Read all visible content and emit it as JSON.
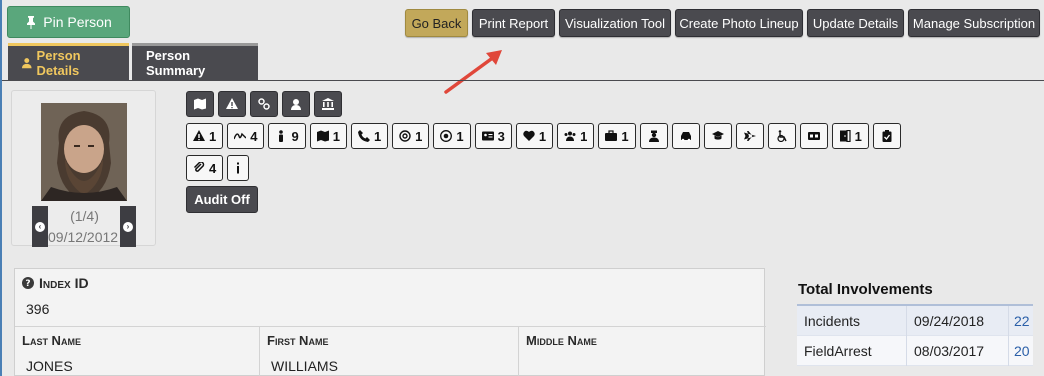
{
  "colors": {
    "accent": "#f0c75e",
    "pin": "#5aa77c",
    "go_back": "#c2a85a",
    "dark_button": "#4a4a4f",
    "link": "#2a5fa8",
    "arrow": "#e0473a"
  },
  "toolbar": {
    "pin_label": "Pin Person",
    "go_back": "Go Back",
    "print_report": "Print Report",
    "visualization_tool": "Visualization Tool",
    "photo_lineup": "Create Photo Lineup",
    "update_details": "Update Details",
    "manage_subscription": "Manage Subscription"
  },
  "tabs": [
    {
      "label": "Person Details",
      "icon": "user-icon",
      "active": true
    },
    {
      "label": "Person Summary",
      "active": false
    }
  ],
  "photo": {
    "counter": "(1/4)",
    "date": "09/12/2012"
  },
  "icon_bar_top": [
    "map-icon",
    "warning-icon",
    "link-icon",
    "user-secret-icon",
    "bank-icon"
  ],
  "icon_bar_main": [
    {
      "icon": "warning-icon",
      "count": "1"
    },
    {
      "icon": "signature-icon",
      "count": "4"
    },
    {
      "icon": "person-icon",
      "count": "9"
    },
    {
      "icon": "map-icon",
      "count": "1"
    },
    {
      "icon": "phone-icon",
      "count": "1"
    },
    {
      "icon": "at-icon",
      "count": "1"
    },
    {
      "icon": "target-icon",
      "count": "1"
    },
    {
      "icon": "id-card-icon",
      "count": "3"
    },
    {
      "icon": "heart-icon",
      "count": "1"
    },
    {
      "icon": "group-icon",
      "count": "1"
    },
    {
      "icon": "briefcase-icon",
      "count": "1"
    },
    {
      "icon": "officer-icon",
      "count": ""
    },
    {
      "icon": "car-icon",
      "count": ""
    },
    {
      "icon": "graduation-cap-icon",
      "count": ""
    },
    {
      "icon": "plane-icon",
      "count": ""
    },
    {
      "icon": "wheelchair-icon",
      "count": ""
    },
    {
      "icon": "language-icon",
      "count": ""
    },
    {
      "icon": "door-icon",
      "count": "1"
    },
    {
      "icon": "clipboard-icon",
      "count": ""
    }
  ],
  "icon_bar_bottom": [
    {
      "icon": "paperclip-icon",
      "count": "4"
    },
    {
      "icon": "info-icon",
      "count": ""
    }
  ],
  "audit_label": "Audit Off",
  "details": {
    "index_label": "Index ID",
    "index_value": "396",
    "last_name_label": "Last Name",
    "last_name": "JONES",
    "first_name_label": "First Name",
    "first_name": "WILLIAMS",
    "middle_name_label": "Middle Name",
    "middle_name": ""
  },
  "involvements": {
    "title": "Total Involvements",
    "rows": [
      {
        "type": "Incidents",
        "date": "09/24/2018",
        "count": "22"
      },
      {
        "type": "FieldArrest",
        "date": "08/03/2017",
        "count": "20"
      }
    ]
  }
}
